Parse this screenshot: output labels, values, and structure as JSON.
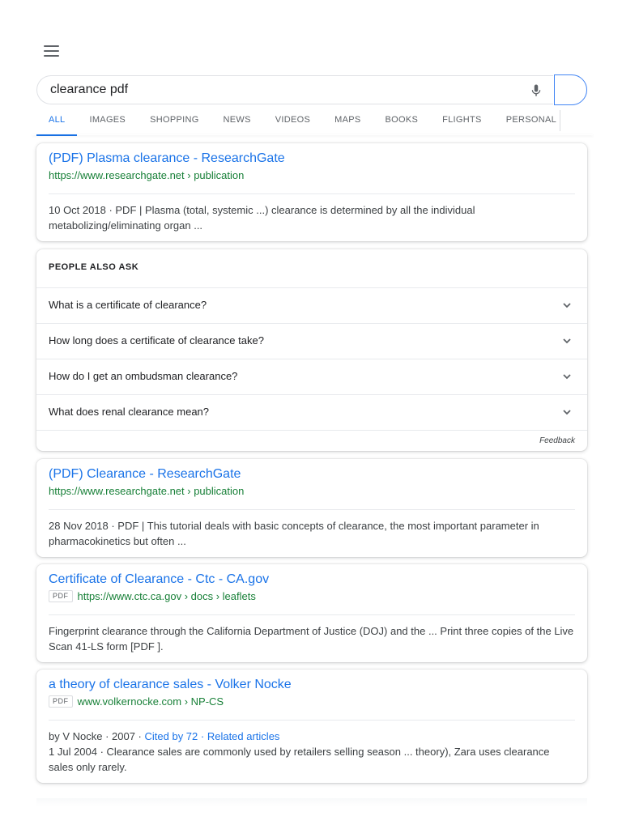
{
  "search": {
    "query": "clearance pdf",
    "menu_icon": "hamburger-menu-icon",
    "mic_icon": "microphone-icon",
    "accent": "#1a73e8"
  },
  "tabs": [
    {
      "label": "ALL",
      "active": true
    },
    {
      "label": "IMAGES"
    },
    {
      "label": "SHOPPING"
    },
    {
      "label": "NEWS"
    },
    {
      "label": "VIDEOS"
    },
    {
      "label": "MAPS"
    },
    {
      "label": "BOOKS"
    },
    {
      "label": "FLIGHTS"
    },
    {
      "label": "PERSONAL"
    }
  ],
  "results": [
    {
      "title": "(PDF) Plasma clearance - ResearchGate",
      "url": "https://www.researchgate.net › publication",
      "snippet": "10 Oct 2018 · PDF | Plasma (total, systemic ...) clearance is determined by all the individual metabolizing/eliminating organ ..."
    },
    {
      "title": "(PDF) Clearance - ResearchGate",
      "url": "https://www.researchgate.net › publication",
      "snippet": "28 Nov 2018 · PDF | This tutorial deals with basic concepts of clearance, the most important parameter in pharmacokinetics but often ..."
    },
    {
      "title": "Certificate of Clearance - Ctc - CA.gov",
      "badge": "PDF",
      "url": "https://www.ctc.ca.gov › docs › leaflets",
      "snippet": "Fingerprint clearance through the California Department of Justice (DOJ) and the ... Print three copies of the Live Scan 41-LS form [PDF ]."
    },
    {
      "title": "a theory of clearance sales - Volker Nocke",
      "badge": "PDF",
      "url": "www.volkernocke.com › NP-CS",
      "meta_prefix": "by V Nocke · 2007 · ",
      "cited_by": "Cited by 72",
      "meta_sep": " · ",
      "related": "Related articles",
      "snippet": "1 Jul 2004 · Clearance sales are commonly used by retailers selling season ... theory), Zara uses clearance sales only rarely."
    }
  ],
  "people_also_ask": {
    "heading": "PEOPLE ALSO ASK",
    "questions": [
      "What is a certificate of clearance?",
      "How long does a certificate of clearance take?",
      "How do I get an ombudsman clearance?",
      "What does renal clearance mean?"
    ],
    "chevron_icon": "chevron-down-icon",
    "feedback": "Feedback"
  }
}
